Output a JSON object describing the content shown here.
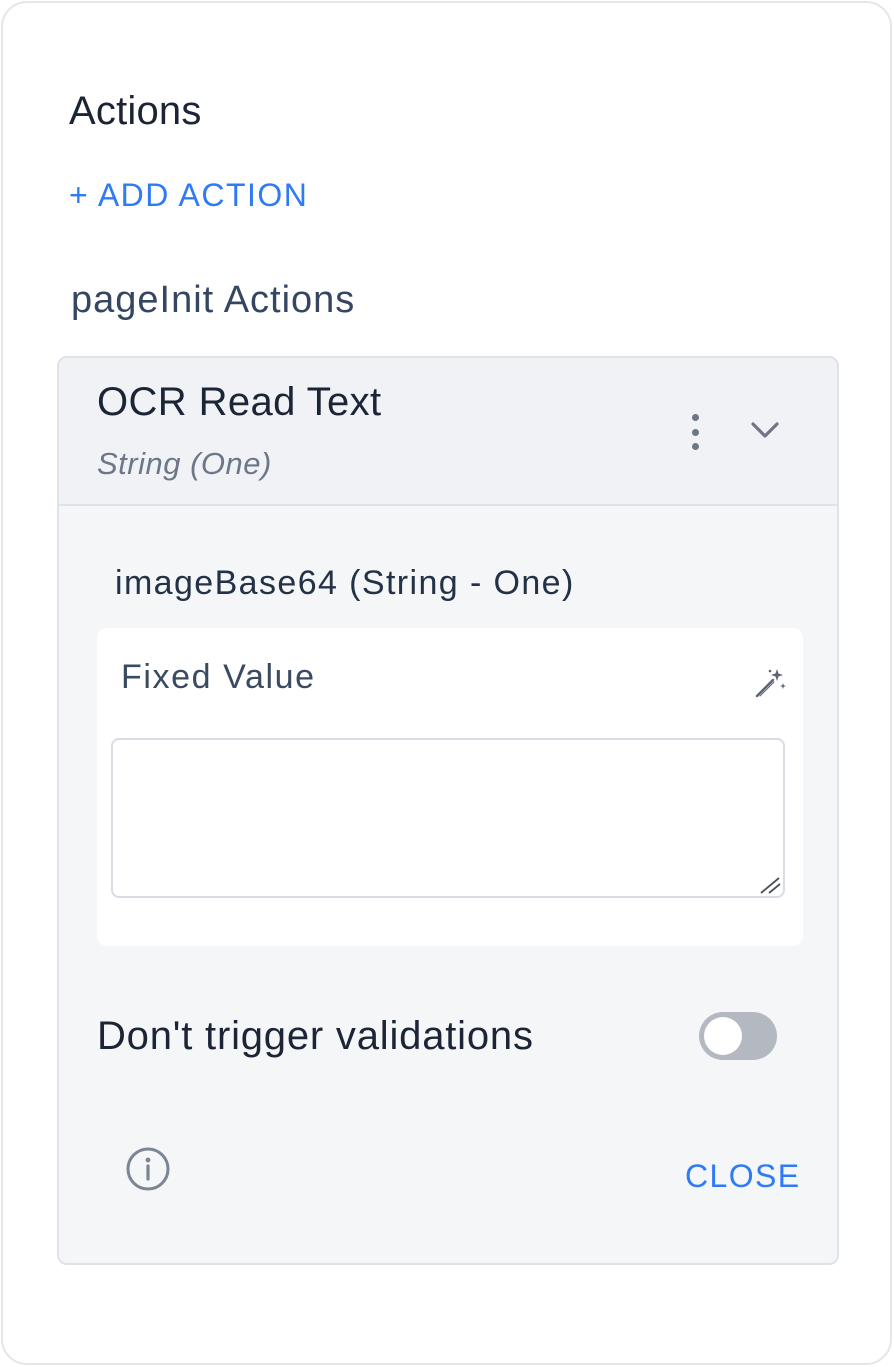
{
  "panel": {
    "title": "Actions",
    "add_action_label": "+ ADD ACTION",
    "group_label": "pageInit Actions"
  },
  "action_card": {
    "title": "OCR Read Text",
    "subtitle": "String (One)",
    "menu_icon": "kebab-menu-icon",
    "expand_icon": "chevron-down-icon",
    "parameter": {
      "label": "imageBase64 (String - One)",
      "mode_label": "Fixed Value",
      "mode_icon": "magic-wand-icon",
      "value": ""
    },
    "toggle": {
      "label": "Don't trigger validations",
      "checked": false
    },
    "info_icon": "info-icon",
    "close_label": "CLOSE"
  },
  "colors": {
    "accent": "#2f7bf5",
    "text_primary": "#1c2536",
    "card_background": "#f5f6f8",
    "toggle_off": "#b4b9c1"
  }
}
